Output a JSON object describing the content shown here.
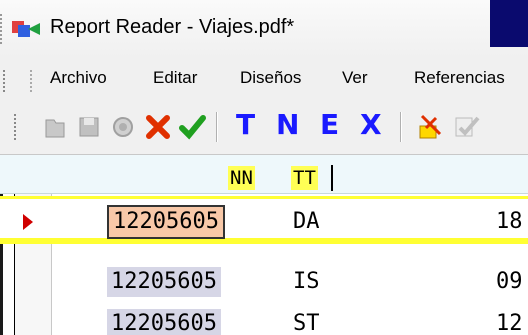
{
  "window": {
    "title": "Report Reader - Viajes.pdf*"
  },
  "menu": [
    {
      "label": "Archivo"
    },
    {
      "label": "Editar"
    },
    {
      "label": "Diseños"
    },
    {
      "label": "Ver"
    },
    {
      "label": "Referencias"
    }
  ],
  "toolbar": {
    "icons": [
      "open-icon",
      "save-icon",
      "record-icon",
      "delete-x-icon",
      "checkmark-icon",
      "separator",
      "T",
      "N",
      "E",
      "X",
      "separator",
      "edit-icon",
      "check-icon"
    ],
    "letters": {
      "t": "T",
      "n": "N",
      "e": "E",
      "x": "X"
    },
    "colors": {
      "t": "#1a1aff",
      "n": "#1a1aff",
      "e": "#1a1aff",
      "x": "#1a1aff",
      "delete": "#e03000",
      "check": "#20a020"
    }
  },
  "grid": {
    "headers": {
      "nn": "NN",
      "tt": "TT"
    },
    "rows": [
      {
        "id": "12205605",
        "code": "DA",
        "value": "18",
        "current": true
      },
      {
        "id": "12205605",
        "code": "IS",
        "value": "09",
        "current": false
      },
      {
        "id": "12205605",
        "code": "ST",
        "value": "12",
        "current": false
      }
    ],
    "colors": {
      "header_highlight": "#ffff55",
      "current_row_border": "#ffff33",
      "selected_cell": "#f8c8a8",
      "shaded_cell": "#d6d6e6",
      "row_marker": "#d00000"
    }
  }
}
